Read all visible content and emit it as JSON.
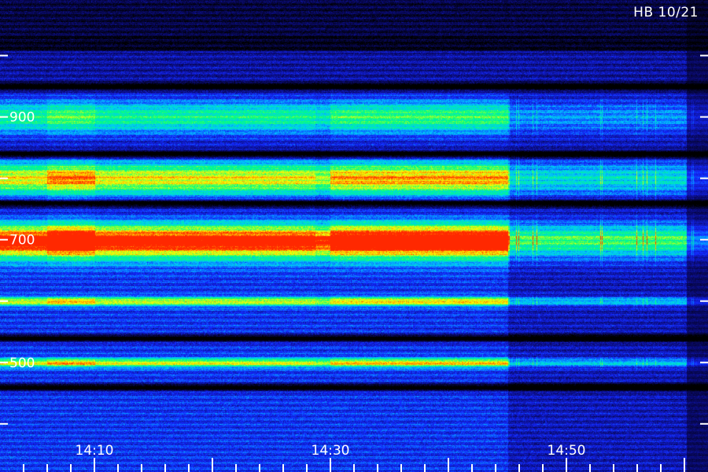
{
  "header": {
    "station_date": "HB 10/21"
  },
  "chart_data": {
    "type": "heatmap",
    "title": "",
    "xlabel": "",
    "ylabel": "",
    "x_tick_labels": [
      "14:10",
      "14:30",
      "14:50"
    ],
    "y_tick_labels": [
      "900",
      "700",
      "500"
    ],
    "x_range_minutes": [
      "14:02",
      "15:02"
    ],
    "y_range": [
      360,
      1020
    ],
    "colormap": [
      "#000000",
      "#0a0a6e",
      "#1428ff",
      "#00c8ff",
      "#00ff80",
      "#ffff00",
      "#ff2800"
    ],
    "bands": [
      {
        "freq": 900,
        "intensity": "medium"
      },
      {
        "freq": 800,
        "intensity": "high"
      },
      {
        "freq": 700,
        "intensity": "very-high"
      },
      {
        "freq": 600,
        "intensity": "medium-line"
      },
      {
        "freq": 500,
        "intensity": "medium-line"
      }
    ],
    "dark_gaps": [
      950,
      840,
      760,
      540,
      460
    ],
    "bright_period_minutes": [
      "14:30",
      "14:45"
    ],
    "dropout_after": "14:45"
  }
}
